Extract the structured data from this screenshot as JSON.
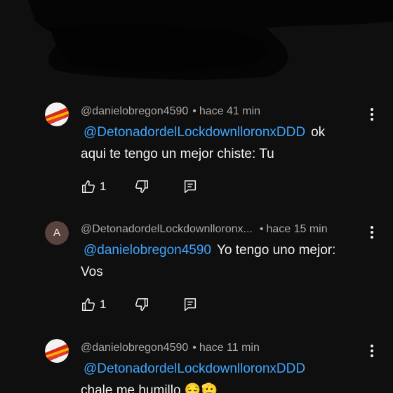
{
  "comments": [
    {
      "author": "@danielobregon4590",
      "time": "hace 41 min",
      "mention": "@DetonadordelLockdownlloronxDDD",
      "text_inline": "ok",
      "text_rest": "aqui te tengo un mejor chiste: Tu",
      "likes": "1",
      "avatar": "danielobregon-avatar"
    },
    {
      "author": "@DetonadordelLockdownlloronx...",
      "avatar_letter": "A",
      "time": "hace 15 min",
      "mention": "@danielobregon4590",
      "text_inline": "Yo tengo uno mejor:",
      "text_rest": "Vos",
      "likes": "1"
    },
    {
      "author": "@danielobregon4590",
      "time": "hace 11 min",
      "mention": "@DetonadordelLockdownlloronxDDD",
      "text_rest": "chale me humillo 😔🫡",
      "avatar": "danielobregon-avatar"
    }
  ],
  "icons": {
    "like": "thumbs-up-icon",
    "dislike": "thumbs-down-icon",
    "reply": "reply-icon",
    "more": "more-vertical-icon"
  },
  "colors": {
    "background": "#0f0f0f",
    "mention": "#3ea6ff",
    "meta": "#aaaaaa",
    "text": "#f1f1f1"
  }
}
